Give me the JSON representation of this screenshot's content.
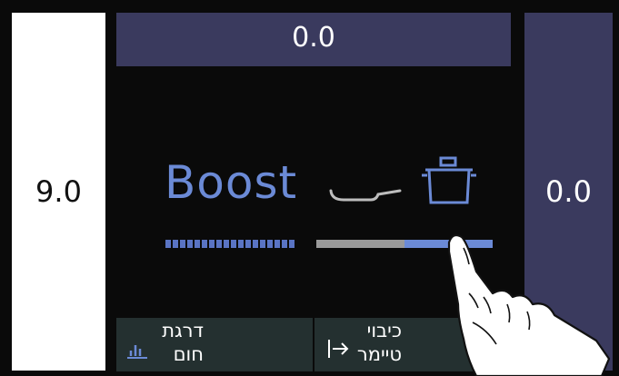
{
  "left_zone": {
    "value": "9.0"
  },
  "top_zone": {
    "value": "0.0"
  },
  "right_zone": {
    "value": "0.0"
  },
  "center": {
    "mode_label": "Boost",
    "icons": [
      "frying-pan-icon",
      "cooking-pot-icon"
    ],
    "slider_value_fraction": 0.5
  },
  "buttons": {
    "heat": {
      "line1": "דרגת",
      "line2": "חום",
      "icon": "bar-chart-icon"
    },
    "timer": {
      "line1": "כיבוי",
      "line2": "טיימר",
      "icon": "arrow-to-bar-icon"
    }
  },
  "colors": {
    "accent": "#6b8ad6",
    "zone": "#3a3a5e",
    "button": "#243030"
  }
}
